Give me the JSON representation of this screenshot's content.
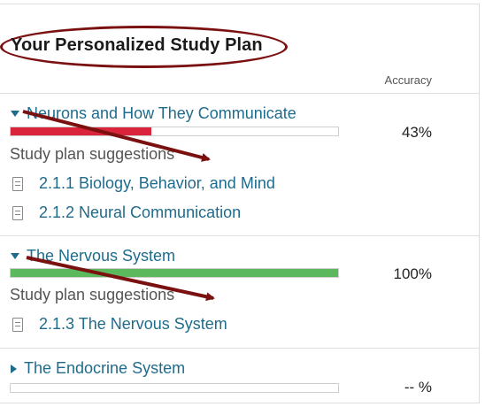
{
  "header": {
    "title": "Your Personalized Study Plan",
    "accuracy_label": "Accuracy"
  },
  "sections": [
    {
      "topic": "Neurons and How They Communicate",
      "expanded": true,
      "accuracy": "43%",
      "progress": 0.43,
      "bar_color": "#d9243b",
      "suggestions_label": "Study plan suggestions",
      "links": [
        "2.1.1 Biology, Behavior, and Mind",
        "2.1.2 Neural Communication"
      ]
    },
    {
      "topic": "The Nervous System",
      "expanded": true,
      "accuracy": "100%",
      "progress": 1.0,
      "bar_color": "#5cb85c",
      "suggestions_label": "Study plan suggestions",
      "links": [
        "2.1.3 The Nervous System"
      ]
    },
    {
      "topic": "The Endocrine System",
      "expanded": false,
      "accuracy": "-- %",
      "progress": 0
    }
  ],
  "annotation_color": "#7a1010"
}
